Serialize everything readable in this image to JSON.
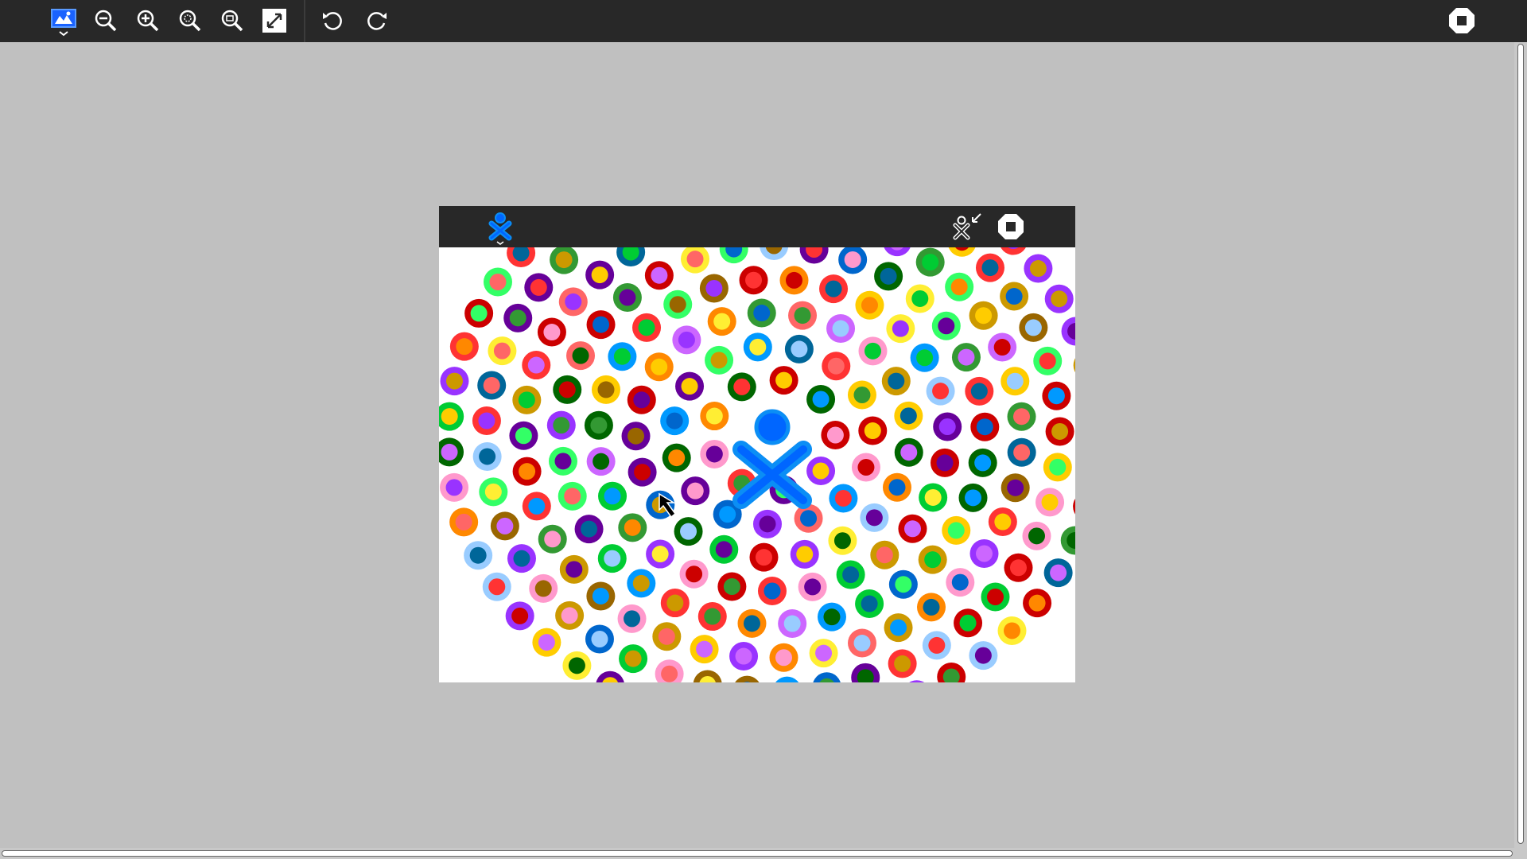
{
  "toolbar": {
    "items": [
      {
        "name": "activity-icon-button",
        "icon": "image-viewer-activity-icon"
      },
      {
        "name": "zoom-out-button",
        "icon": "zoom-out-icon"
      },
      {
        "name": "zoom-in-button",
        "icon": "zoom-in-icon"
      },
      {
        "name": "zoom-original-button",
        "icon": "zoom-original-icon"
      },
      {
        "name": "zoom-fit-button",
        "icon": "zoom-best-fit-icon"
      },
      {
        "name": "fullscreen-button",
        "icon": "fullscreen-icon"
      },
      {
        "name": "rotate-left-button",
        "icon": "rotate-anticlockwise-icon"
      },
      {
        "name": "rotate-right-button",
        "icon": "rotate-clockwise-icon"
      },
      {
        "name": "stop-button",
        "icon": "stop-icon"
      }
    ],
    "colors": {
      "bar": "#282828",
      "icon": "#ffffff",
      "activity": "#1a62ff"
    }
  },
  "image": {
    "description_icons": [
      "xo-logo-icon",
      "unfullscreen-icon",
      "stop-icon"
    ],
    "colors": {
      "background": "#ffffff",
      "bar": "#282828",
      "xo_stroke": "#0b8ef5",
      "xo_fill": "#0066ff"
    }
  }
}
